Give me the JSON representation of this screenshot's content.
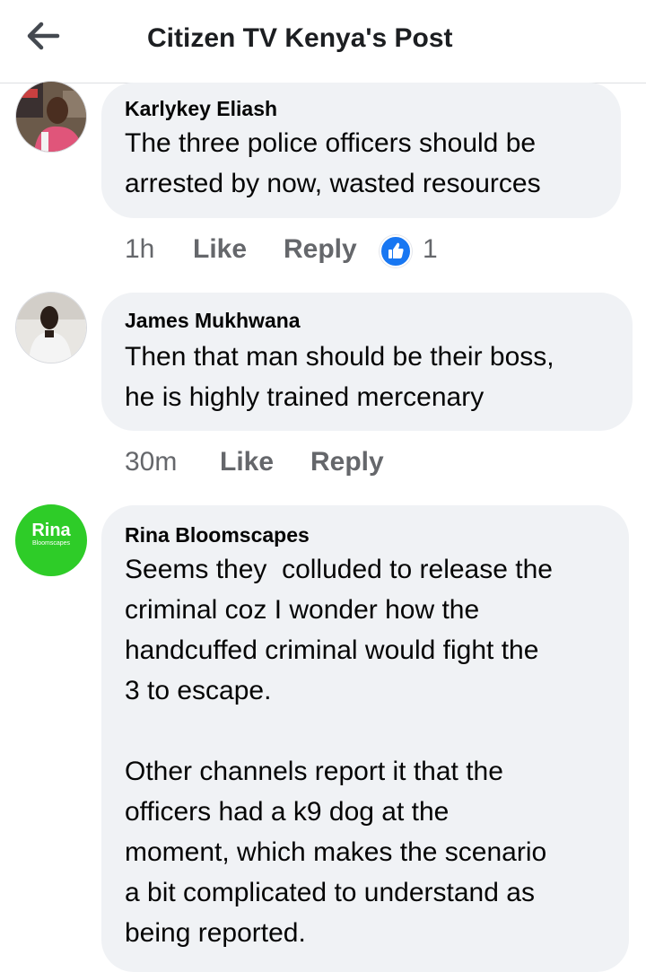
{
  "header": {
    "title": "Citizen TV Kenya's Post"
  },
  "comments": [
    {
      "author": "Karlykey Eliash",
      "text": "The three police officers should be\narrested by now, wasted resources",
      "time": "1h",
      "like_label": "Like",
      "reply_label": "Reply",
      "reaction_count": "1"
    },
    {
      "author": "James Mukhwana",
      "text": "Then that man should be their boss,\nhe is highly trained mercenary",
      "time": "30m",
      "like_label": "Like",
      "reply_label": "Reply"
    },
    {
      "author": "Rina Bloomscapes",
      "avatar_text": "Rina",
      "avatar_subtext": "Bloomscapes",
      "text": "Seems they  colluded to release the\ncriminal coz I wonder how the\nhandcuffed criminal would fight the\n3 to escape.\n\nOther channels report it that the\nofficers had a k9 dog at the\nmoment, which makes the scenario\na bit complicated to understand as\nbeing reported."
    }
  ],
  "colors": {
    "bubble": "#f0f2f5",
    "meta": "#65676b",
    "like_blue": "#1877f2",
    "rina_green": "#2ecc28"
  }
}
